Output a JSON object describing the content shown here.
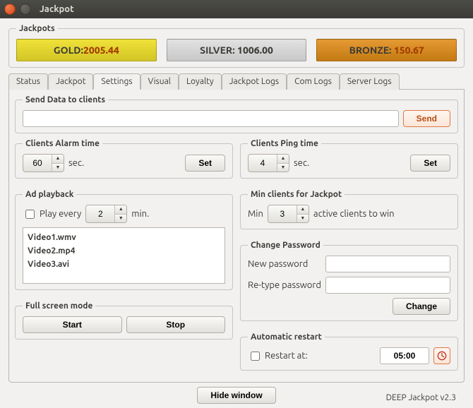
{
  "window": {
    "title": "Jackpot"
  },
  "jackpots": {
    "group_label": "Jackpots",
    "gold": {
      "label": "GOLD:",
      "value": "2005.44"
    },
    "silver": {
      "label": "SILVER:",
      "value": "1006.00"
    },
    "bronze": {
      "label": "BRONZE:",
      "value": "150.67"
    }
  },
  "tabs": {
    "status": "Status",
    "jackpot": "Jackpot",
    "settings": "Settings",
    "visual": "Visual",
    "loyalty": "Loyalty",
    "jackpot_logs": "Jackpot Logs",
    "com_logs": "Com Logs",
    "server_logs": "Server Logs"
  },
  "send_data": {
    "group_label": "Send Data to clients",
    "input_value": "",
    "send_btn": "Send"
  },
  "alarm": {
    "group_label": "Clients Alarm time",
    "value": "60",
    "unit": "sec.",
    "set_btn": "Set"
  },
  "ping": {
    "group_label": "Clients Ping time",
    "value": "4",
    "unit": "sec.",
    "set_btn": "Set"
  },
  "ad": {
    "group_label": "Ad playback",
    "play_every_label": "Play every",
    "play_every_checked": false,
    "interval": "2",
    "unit": "min.",
    "videos": [
      "Video1.wmv",
      "Video2.mp4",
      "Video3.avi"
    ]
  },
  "min_clients": {
    "group_label": "Min clients for Jackpot",
    "prefix": "Min",
    "value": "3",
    "suffix": "active clients to win"
  },
  "password": {
    "group_label": "Change Password",
    "new_label": "New password",
    "retype_label": "Re-type password",
    "change_btn": "Change"
  },
  "fullscreen": {
    "group_label": "Full screen mode",
    "start_btn": "Start",
    "stop_btn": "Stop"
  },
  "restart": {
    "group_label": "Automatic restart",
    "restart_label": "Restart at:",
    "checked": false,
    "time": "05:00"
  },
  "footer": {
    "hide_btn": "Hide window",
    "brand": "DEEP Jackpot v2.3"
  }
}
